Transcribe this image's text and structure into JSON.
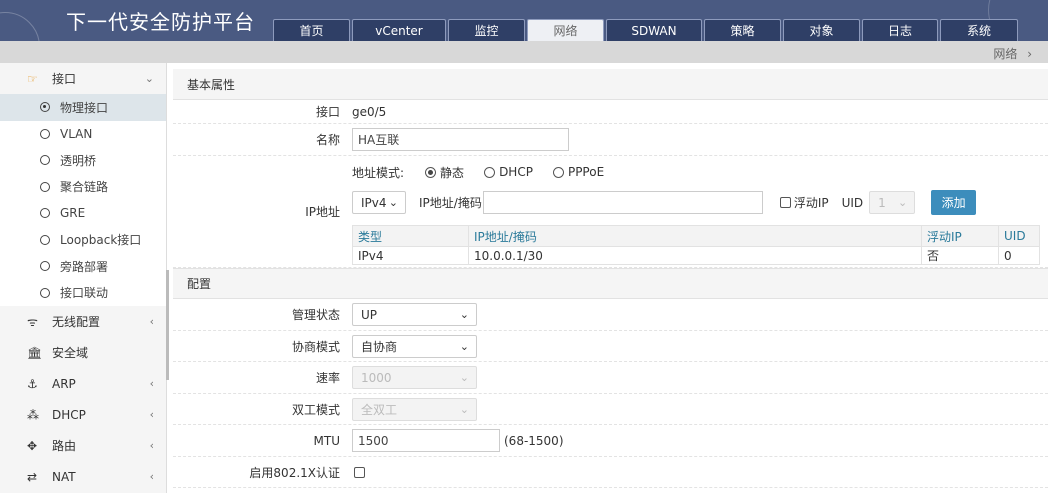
{
  "app": {
    "title": "下一代安全防护平台"
  },
  "tabs": [
    {
      "label": "首页",
      "active": false
    },
    {
      "label": "vCenter",
      "active": false
    },
    {
      "label": "监控",
      "active": false
    },
    {
      "label": "网络",
      "active": true
    },
    {
      "label": "SDWAN",
      "active": false
    },
    {
      "label": "策略",
      "active": false
    },
    {
      "label": "对象",
      "active": false
    },
    {
      "label": "日志",
      "active": false
    },
    {
      "label": "系统",
      "active": false
    }
  ],
  "breadcrumb": {
    "text": "网络",
    "arrow": "›"
  },
  "sidebar": {
    "interface_group": {
      "label": "接口",
      "icon": "hand-pointer-icon",
      "expanded": true
    },
    "interface_items": [
      {
        "label": "物理接口",
        "active": true
      },
      {
        "label": "VLAN",
        "active": false
      },
      {
        "label": "透明桥",
        "active": false
      },
      {
        "label": "聚合链路",
        "active": false
      },
      {
        "label": "GRE",
        "active": false
      },
      {
        "label": "Loopback接口",
        "active": false
      },
      {
        "label": "旁路部署",
        "active": false
      },
      {
        "label": "接口联动",
        "active": false
      }
    ],
    "groups": [
      {
        "label": "无线配置",
        "icon": "wifi-icon",
        "chevron": "‹"
      },
      {
        "label": "安全域",
        "icon": "bank-icon",
        "chevron": ""
      },
      {
        "label": "ARP",
        "icon": "anchor-icon",
        "chevron": "‹"
      },
      {
        "label": "DHCP",
        "icon": "cubes-icon",
        "chevron": "‹"
      },
      {
        "label": "路由",
        "icon": "arrows-move-icon",
        "chevron": "‹"
      },
      {
        "label": "NAT",
        "icon": "exchange-icon",
        "chevron": "‹"
      }
    ]
  },
  "basic": {
    "header": "基本属性",
    "interface_label": "接口",
    "interface_value": "ge0/5",
    "name_label": "名称",
    "name_value": "HA互联",
    "ip_label": "IP地址",
    "addr_mode_label": "地址模式:",
    "addr_modes": [
      {
        "label": "静态",
        "checked": true
      },
      {
        "label": "DHCP",
        "checked": false
      },
      {
        "label": "PPPoE",
        "checked": false
      }
    ],
    "ip_version": "IPv4",
    "ip_mask_label": "IP地址/掩码",
    "ip_mask_value": "",
    "float_ip_label": "浮动IP",
    "uid_label": "UID",
    "uid_value": "1",
    "add_label": "添加",
    "table": {
      "columns": [
        "类型",
        "IP地址/掩码",
        "浮动IP",
        "UID"
      ],
      "rows": [
        [
          "IPv4",
          "10.0.0.1/30",
          "否",
          "0"
        ]
      ]
    }
  },
  "config": {
    "header": "配置",
    "admin_state_label": "管理状态",
    "admin_state_value": "UP",
    "negotiation_label": "协商模式",
    "negotiation_value": "自协商",
    "speed_label": "速率",
    "speed_value": "1000",
    "duplex_label": "双工模式",
    "duplex_value": "全双工",
    "mtu_label": "MTU",
    "mtu_value": "1500",
    "mtu_hint": "(68-1500)",
    "dot1x_label": "启用802.1X认证",
    "dot1x_checked": false
  },
  "colors": {
    "header_bg": "#4a5a82",
    "tab_bg": "#2f3f66",
    "accent": "#3c8dbc"
  }
}
